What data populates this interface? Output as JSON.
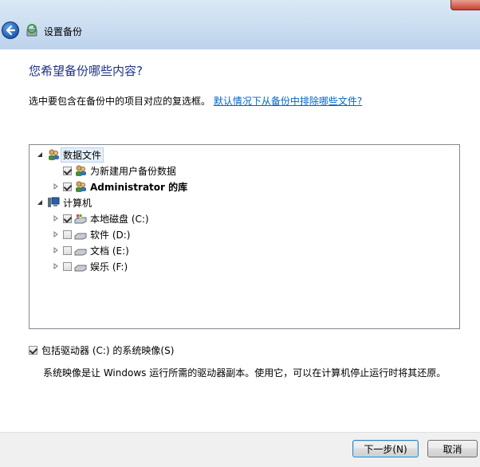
{
  "window": {
    "title": "设置备份"
  },
  "page": {
    "heading": "您希望备份哪些内容?",
    "instruction": "选中要包含在备份中的项目对应的复选框。",
    "link": "默认情况下从备份中排除哪些文件?"
  },
  "tree": {
    "data_files": {
      "label": "数据文件",
      "new_users": "为新建用户备份数据",
      "admin_lib": "Administrator 的库"
    },
    "computer": {
      "label": "计算机",
      "drives": [
        {
          "label": "本地磁盘 (C:)",
          "checked": true
        },
        {
          "label": "软件 (D:)",
          "checked": false
        },
        {
          "label": "文档 (E:)",
          "checked": false
        },
        {
          "label": "娱乐 (F:)",
          "checked": false
        }
      ]
    }
  },
  "system_image": {
    "label": "包括驱动器 (C:) 的系统映像(S)",
    "checked": true,
    "description": "系统映像是让 Windows 运行所需的驱动器副本。使用它，可以在计算机停止运行时将其还原。"
  },
  "buttons": {
    "next": "下一步(N)",
    "cancel": "取消"
  }
}
